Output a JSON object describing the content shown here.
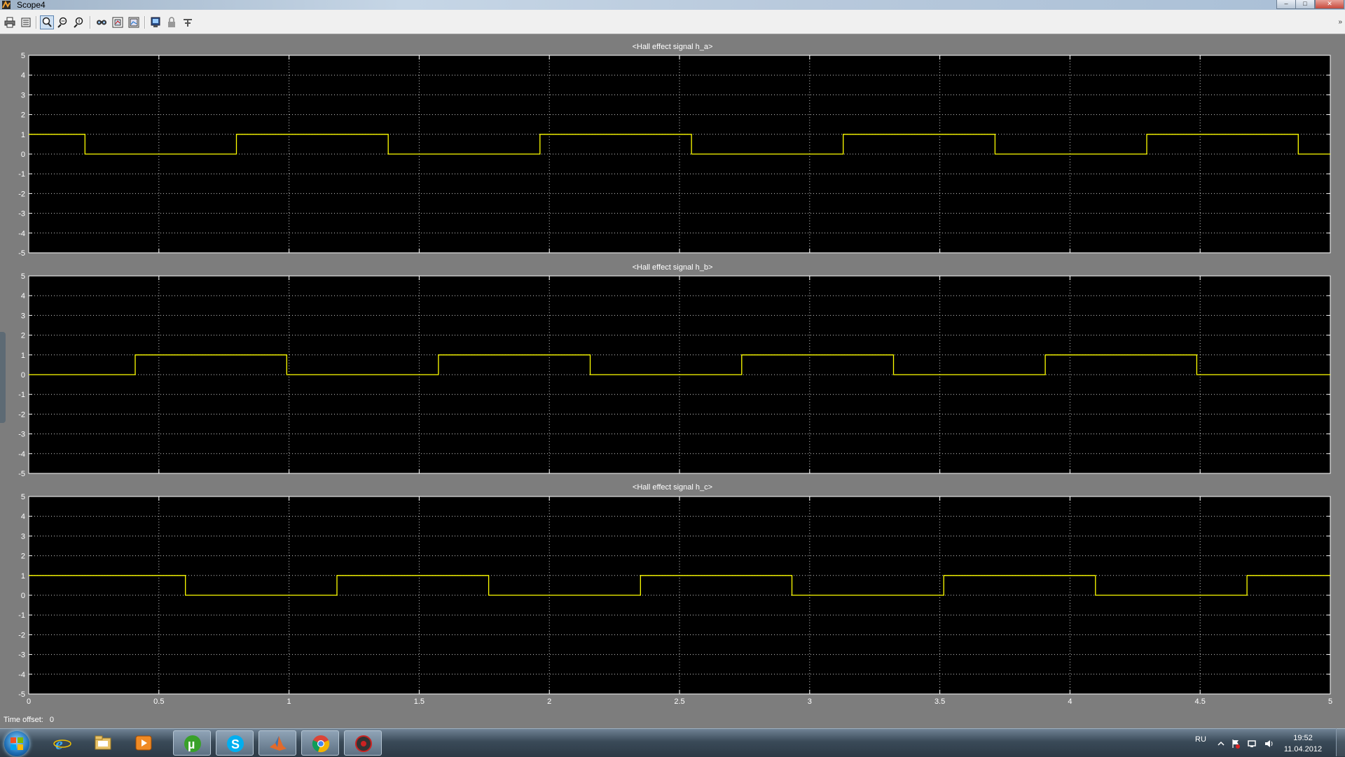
{
  "window": {
    "title": "Scope4",
    "controls": [
      "–",
      "□",
      "✕"
    ]
  },
  "toolbar": {
    "buttons": [
      {
        "name": "print-icon",
        "label": "Print"
      },
      {
        "name": "parameters-icon",
        "label": "Parameters"
      },
      {
        "name": "zoom-icon",
        "label": "Zoom",
        "active": true
      },
      {
        "name": "zoom-x-icon",
        "label": "Zoom X-axis"
      },
      {
        "name": "zoom-y-icon",
        "label": "Zoom Y-axis"
      },
      {
        "name": "autoscale-icon",
        "label": "Autoscale"
      },
      {
        "name": "save-axes-icon",
        "label": "Save axes settings"
      },
      {
        "name": "restore-axes-icon",
        "label": "Restore saved axes settings"
      },
      {
        "name": "floating-scope-icon",
        "label": "Floating scope"
      },
      {
        "name": "lock-axes-icon",
        "label": "Lock axes selection"
      },
      {
        "name": "signal-selector-icon",
        "label": "Signal selection"
      }
    ],
    "more": "»"
  },
  "plots": [
    {
      "title": "<Hall effect signal h_a>"
    },
    {
      "title": "<Hall effect signal h_b>"
    },
    {
      "title": "<Hall effect signal h_c>"
    }
  ],
  "time_offset": {
    "label": "Time offset:",
    "value": "0"
  },
  "chart_data": [
    {
      "type": "line",
      "title": "<Hall effect signal h_a>",
      "xlim": [
        0,
        5
      ],
      "ylim": [
        -5,
        5
      ],
      "x_ticks": [
        "0",
        "0.5",
        "1",
        "1.5",
        "2",
        "2.5",
        "3",
        "3.5",
        "4",
        "4.5",
        "5"
      ],
      "y_ticks": [
        "5",
        "4",
        "3",
        "2",
        "1",
        "0",
        "-1",
        "-2",
        "-3",
        "-4",
        "-5"
      ],
      "show_x_tick_labels": false,
      "grid": true,
      "background": "#000000",
      "line_color": "#ffff00",
      "series": [
        {
          "x": [
            0,
            0.216,
            0.216,
            0.798,
            0.798,
            1.381,
            1.381,
            1.964,
            1.964,
            2.546,
            2.546,
            3.129,
            3.129,
            3.712,
            3.712,
            4.295,
            4.295,
            4.877,
            4.877,
            5
          ],
          "values": [
            1,
            1,
            0,
            0,
            1,
            1,
            0,
            0,
            1,
            1,
            0,
            0,
            1,
            1,
            0,
            0,
            1,
            1,
            0,
            0
          ]
        }
      ]
    },
    {
      "type": "line",
      "title": "<Hall effect signal h_b>",
      "xlim": [
        0,
        5
      ],
      "ylim": [
        -5,
        5
      ],
      "x_ticks": [
        "0",
        "0.5",
        "1",
        "1.5",
        "2",
        "2.5",
        "3",
        "3.5",
        "4",
        "4.5",
        "5"
      ],
      "y_ticks": [
        "5",
        "4",
        "3",
        "2",
        "1",
        "0",
        "-1",
        "-2",
        "-3",
        "-4",
        "-5"
      ],
      "show_x_tick_labels": false,
      "grid": true,
      "background": "#000000",
      "line_color": "#ffff00",
      "series": [
        {
          "x": [
            0,
            0.409,
            0.409,
            0.991,
            0.991,
            1.574,
            1.574,
            2.157,
            2.157,
            2.739,
            2.739,
            3.322,
            3.322,
            3.905,
            3.905,
            4.487,
            4.487,
            5
          ],
          "values": [
            0,
            0,
            1,
            1,
            0,
            0,
            1,
            1,
            0,
            0,
            1,
            1,
            0,
            0,
            1,
            1,
            0,
            0
          ]
        }
      ]
    },
    {
      "type": "line",
      "title": "<Hall effect signal h_c>",
      "xlim": [
        0,
        5
      ],
      "ylim": [
        -5,
        5
      ],
      "x_ticks": [
        "0",
        "0.5",
        "1",
        "1.5",
        "2",
        "2.5",
        "3",
        "3.5",
        "4",
        "4.5",
        "5"
      ],
      "y_ticks": [
        "5",
        "4",
        "3",
        "2",
        "1",
        "0",
        "-1",
        "-2",
        "-3",
        "-4",
        "-5"
      ],
      "show_x_tick_labels": true,
      "grid": true,
      "background": "#000000",
      "line_color": "#ffff00",
      "series": [
        {
          "x": [
            0,
            0.602,
            0.602,
            1.184,
            1.184,
            1.767,
            1.767,
            2.35,
            2.35,
            2.932,
            2.932,
            3.515,
            3.515,
            4.098,
            4.098,
            4.68,
            4.68,
            5
          ],
          "values": [
            1,
            1,
            0,
            0,
            1,
            1,
            0,
            0,
            1,
            1,
            0,
            0,
            1,
            1,
            0,
            0,
            1,
            1
          ]
        }
      ]
    }
  ],
  "taskbar": {
    "apps": [
      {
        "name": "internet-explorer-icon"
      },
      {
        "name": "file-explorer-icon"
      },
      {
        "name": "media-player-icon"
      },
      {
        "name": "utorrent-icon",
        "active": true
      },
      {
        "name": "skype-icon",
        "active": true
      },
      {
        "name": "matlab-icon",
        "active": true
      },
      {
        "name": "chrome-icon",
        "active": true
      },
      {
        "name": "audio-app-icon",
        "active": true
      }
    ],
    "language": "RU",
    "time": "19:52",
    "date": "11.04.2012"
  }
}
